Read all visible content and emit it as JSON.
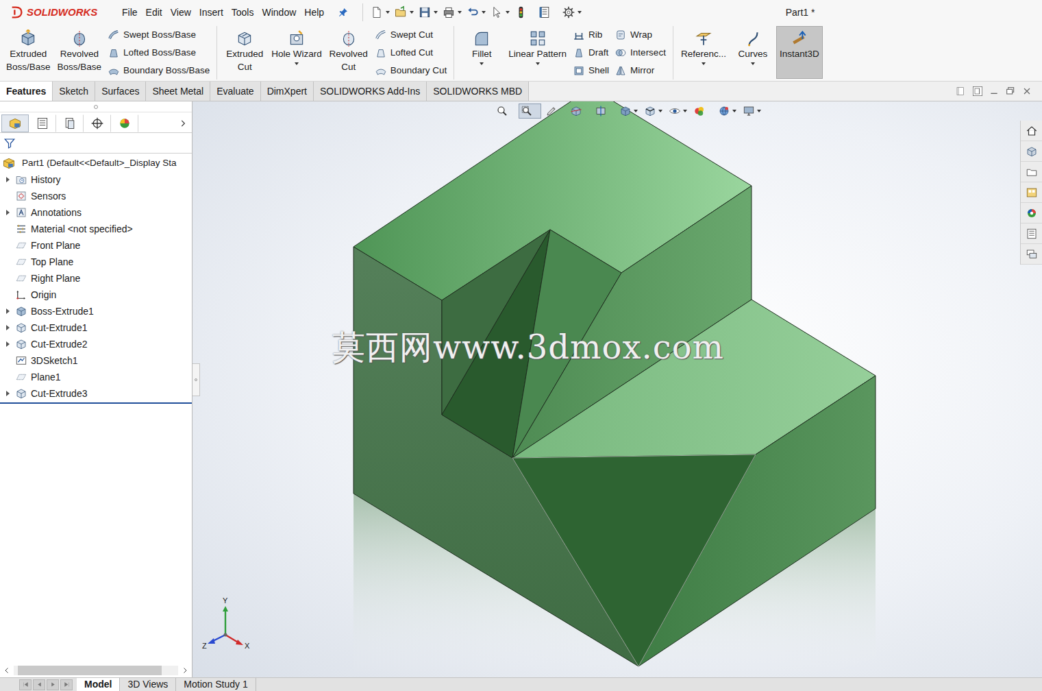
{
  "app": {
    "logo": "SOLIDWORKS"
  },
  "menu": [
    {
      "label": "File"
    },
    {
      "label": "Edit"
    },
    {
      "label": "View"
    },
    {
      "label": "Insert"
    },
    {
      "label": "Tools"
    },
    {
      "label": "Window"
    },
    {
      "label": "Help"
    }
  ],
  "quick_toolbar": [
    {
      "dropdown": true
    },
    {
      "dropdown": true
    },
    {
      "dropdown": true
    },
    {
      "dropdown": true
    },
    {
      "dropdown": true
    },
    {
      "dropdown": true
    },
    {
      "dropdown": false
    },
    {
      "dropdown": false
    },
    {
      "dropdown": true
    }
  ],
  "window": {
    "title": "Part1 *"
  },
  "ribbon": [
    {
      "items": [
        {
          "kind": "big",
          "lines": [
            "Extruded",
            "Boss/Base"
          ],
          "dropdown": false,
          "selected": false
        },
        {
          "kind": "big",
          "lines": [
            "Revolved",
            "Boss/Base"
          ],
          "dropdown": false,
          "selected": false
        },
        {
          "kind": "column",
          "entries": [
            "Swept Boss/Base",
            "Lofted Boss/Base",
            "Boundary Boss/Base"
          ]
        }
      ]
    },
    {
      "items": [
        {
          "kind": "big",
          "lines": [
            "Extruded",
            "Cut"
          ],
          "dropdown": false,
          "selected": false
        },
        {
          "kind": "big",
          "lines": [
            "Hole Wizard"
          ],
          "dropdown": true,
          "selected": false
        },
        {
          "kind": "big",
          "lines": [
            "Revolved",
            "Cut"
          ],
          "dropdown": false,
          "selected": false
        },
        {
          "kind": "column",
          "entries": [
            "Swept Cut",
            "Lofted Cut",
            "Boundary Cut"
          ]
        }
      ]
    },
    {
      "items": [
        {
          "kind": "big",
          "lines": [
            "Fillet"
          ],
          "dropdown": true,
          "selected": false
        },
        {
          "kind": "big",
          "lines": [
            "Linear Pattern"
          ],
          "dropdown": true,
          "selected": false
        },
        {
          "kind": "column",
          "entries": [
            "Rib",
            "Draft",
            "Shell"
          ]
        },
        {
          "kind": "column",
          "entries": [
            "Wrap",
            "Intersect",
            "Mirror"
          ]
        }
      ]
    },
    {
      "items": [
        {
          "kind": "big",
          "lines": [
            "Referenc..."
          ],
          "dropdown": true,
          "selected": false
        },
        {
          "kind": "big",
          "lines": [
            "Curves"
          ],
          "dropdown": true,
          "selected": false
        },
        {
          "kind": "big",
          "lines": [
            "Instant3D"
          ],
          "dropdown": false,
          "selected": true
        }
      ]
    }
  ],
  "tabs": [
    {
      "label": "Features",
      "selected": true
    },
    {
      "label": "Sketch",
      "selected": false
    },
    {
      "label": "Surfaces",
      "selected": false
    },
    {
      "label": "Sheet Metal",
      "selected": false
    },
    {
      "label": "Evaluate",
      "selected": false
    },
    {
      "label": "DimXpert",
      "selected": false
    },
    {
      "label": "SOLIDWORKS Add-Ins",
      "selected": false
    },
    {
      "label": "SOLIDWORKS MBD",
      "selected": false
    }
  ],
  "panel_tabs": [
    {
      "selected": true
    },
    {
      "selected": false
    },
    {
      "selected": false
    },
    {
      "selected": false
    },
    {
      "selected": false
    }
  ],
  "tree": {
    "root": "Part1  (Default<<Default>_Display Sta",
    "items": [
      {
        "label": "History",
        "expandable": true
      },
      {
        "label": "Sensors",
        "expandable": false
      },
      {
        "label": "Annotations",
        "expandable": true
      },
      {
        "label": "Material <not specified>",
        "expandable": false
      },
      {
        "label": "Front Plane",
        "expandable": false
      },
      {
        "label": "Top Plane",
        "expandable": false
      },
      {
        "label": "Right Plane",
        "expandable": false
      },
      {
        "label": "Origin",
        "expandable": false
      },
      {
        "label": "Boss-Extrude1",
        "expandable": true
      },
      {
        "label": "Cut-Extrude1",
        "expandable": true
      },
      {
        "label": "Cut-Extrude2",
        "expandable": true
      },
      {
        "label": "3DSketch1",
        "expandable": false
      },
      {
        "label": "Plane1",
        "expandable": false
      },
      {
        "label": "Cut-Extrude3",
        "expandable": true
      }
    ]
  },
  "heads_up": [
    {
      "selected": false,
      "dropdown": false
    },
    {
      "selected": true,
      "dropdown": false
    },
    {
      "selected": false,
      "dropdown": false
    },
    {
      "selected": false,
      "dropdown": false
    },
    {
      "selected": false,
      "dropdown": false
    },
    {
      "selected": false,
      "dropdown": true
    },
    {
      "selected": false,
      "dropdown": true
    },
    {
      "selected": false,
      "dropdown": true
    },
    {
      "selected": false,
      "dropdown": false
    },
    {
      "selected": false,
      "dropdown": true
    },
    {
      "selected": false,
      "dropdown": true
    }
  ],
  "watermark": "莫西网www.3dmox.com",
  "triad": {
    "y": "Y",
    "z": "Z",
    "x": "X"
  },
  "bottom_tabs": [
    {
      "label": "Model",
      "selected": true
    },
    {
      "label": "3D Views",
      "selected": false
    },
    {
      "label": "Motion Study 1",
      "selected": false
    }
  ]
}
